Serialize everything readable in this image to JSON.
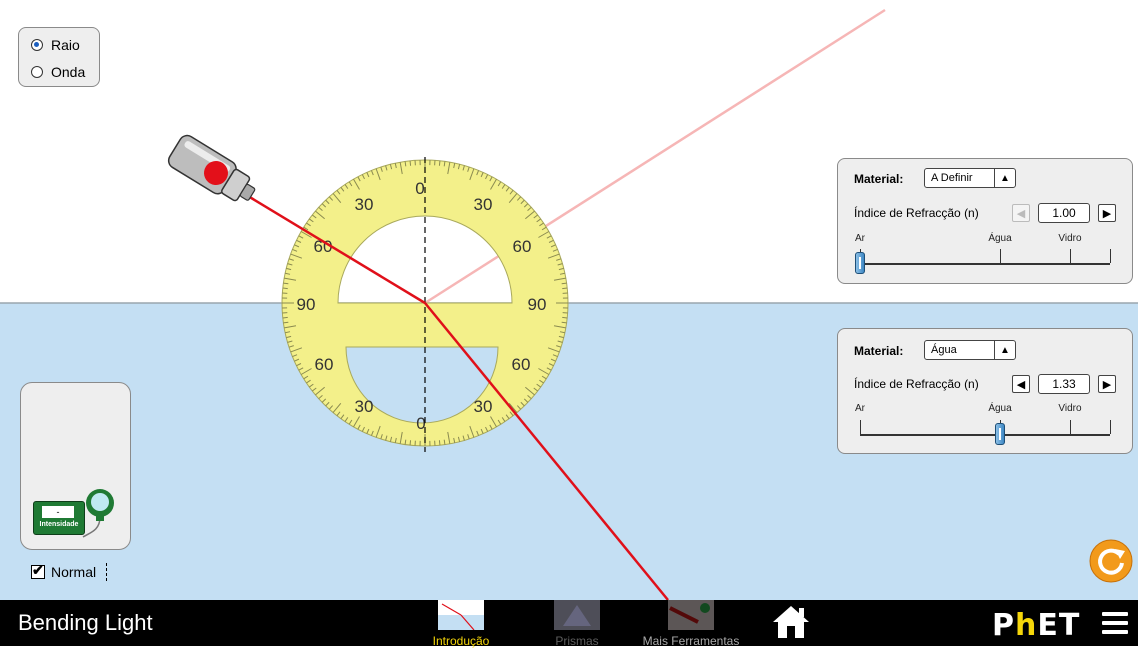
{
  "mode_panel": {
    "options": [
      {
        "label": "Raio",
        "selected": true
      },
      {
        "label": "Onda",
        "selected": false
      }
    ]
  },
  "protractor": {
    "tick_labels": [
      "0",
      "30",
      "60",
      "90",
      "60",
      "30",
      "0",
      "30",
      "60",
      "90",
      "60",
      "30"
    ]
  },
  "top_medium": {
    "material_label": "Material:",
    "material_value": "A Definir",
    "index_label": "Índice de Refracção (n)",
    "index_value": "1.00",
    "index_fraction": 0.0,
    "slider_labels": {
      "ar": "Ar",
      "agua": "Água",
      "vidro": "Vidro"
    },
    "decrement_disabled": true
  },
  "bottom_medium": {
    "material_label": "Material:",
    "material_value": "Água",
    "index_label": "Índice de Refracção (n)",
    "index_value": "1.33",
    "index_fraction": 0.5,
    "slider_labels": {
      "ar": "Ar",
      "agua": "Água",
      "vidro": "Vidro"
    },
    "decrement_disabled": false
  },
  "intensity_meter": {
    "label": "Intensidade",
    "readout": "-"
  },
  "normal_checkbox": {
    "label": "Normal",
    "checked": true
  },
  "navbar": {
    "title": "Bending Light",
    "screens": [
      {
        "label": "Introdução",
        "active": true
      },
      {
        "label": "Prismas",
        "active": false
      },
      {
        "label": "Mais Ferramentas",
        "active": false
      }
    ],
    "logo_text_a": "P",
    "logo_text_b": "h",
    "logo_text_c": "ET"
  },
  "colors": {
    "water": "#c4dff3",
    "laser": "#e0101a",
    "reflected": "#f6b6b6",
    "protractor": "#f3f08a",
    "active_nav": "#f5d60a",
    "reset": "#f29a1b"
  }
}
